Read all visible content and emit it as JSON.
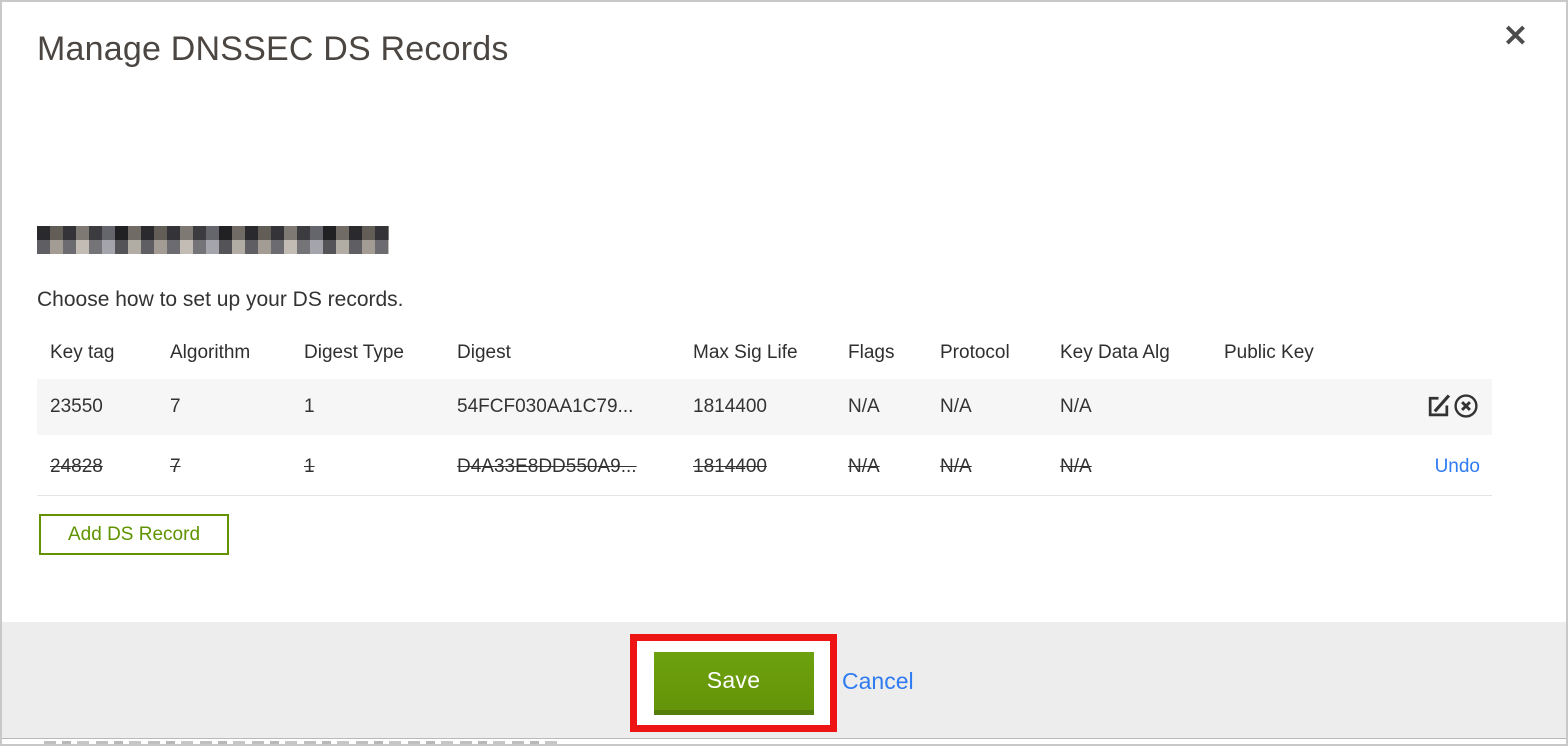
{
  "window": {
    "title": "Manage DNSSEC DS Records"
  },
  "icons": {
    "close": "✕"
  },
  "domain": {
    "redacted": true
  },
  "instruction": "Choose how to set up your DS records.",
  "table": {
    "headers": [
      "Key tag",
      "Algorithm",
      "Digest Type",
      "Digest",
      "Max Sig Life",
      "Flags",
      "Protocol",
      "Key Data Alg",
      "Public Key"
    ],
    "rows": [
      {
        "key_tag": "23550",
        "algorithm": "7",
        "digest_type": "1",
        "digest": "54FCF030AA1C79...",
        "max_sig_life": "1814400",
        "flags": "N/A",
        "protocol": "N/A",
        "key_data_alg": "N/A",
        "public_key": "",
        "state": "active"
      },
      {
        "key_tag": "24828",
        "algorithm": "7",
        "digest_type": "1",
        "digest": "D4A33E8DD550A9...",
        "max_sig_life": "1814400",
        "flags": "N/A",
        "protocol": "N/A",
        "key_data_alg": "N/A",
        "public_key": "",
        "state": "marked-for-deletion",
        "undo_label": "Undo"
      }
    ]
  },
  "actions": {
    "add_ds_record": "Add DS Record",
    "save": "Save",
    "cancel": "Cancel"
  },
  "colors": {
    "accent_green": "#689a0b",
    "green_dark": "#567e0a",
    "outline_green": "#649203",
    "link_blue": "#2e7bf2",
    "annotation_red": "#ee1414",
    "footer_bg": "#ededed",
    "row_bg": "#f6f6f6"
  }
}
